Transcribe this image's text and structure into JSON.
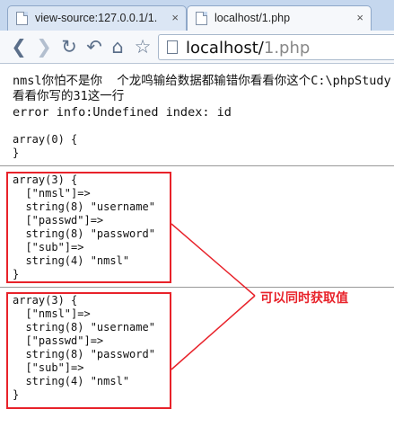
{
  "tabs": [
    {
      "label": "view-source:127.0.0.1/1.",
      "close": "×"
    },
    {
      "label": "localhost/1.php",
      "close": "×"
    }
  ],
  "nav": {
    "back": "❮",
    "forward": "❯",
    "reload": "↻",
    "undo": "↶",
    "home": "⌂",
    "bookmark": "☆"
  },
  "address": {
    "host": "localhost/",
    "path": "1.php"
  },
  "page": {
    "line1": "nmsl你怕不是你  个龙鸣输给数据都输错你看看你这个C:\\phpStudy",
    "line2": "看看你写的31这一行",
    "line3": "error info:Undefined index: id",
    "empty_array": "array(0) {\n}",
    "dump1": "array(3) {\n  [\"nmsl\"]=>\n  string(8) \"username\"\n  [\"passwd\"]=>\n  string(8) \"password\"\n  [\"sub\"]=>\n  string(4) \"nmsl\"\n}",
    "dump2": "array(3) {\n  [\"nmsl\"]=>\n  string(8) \"username\"\n  [\"passwd\"]=>\n  string(8) \"password\"\n  [\"sub\"]=>\n  string(4) \"nmsl\"\n}"
  },
  "annotation": {
    "text": "可以同时获取值",
    "color": "#e8222a"
  }
}
